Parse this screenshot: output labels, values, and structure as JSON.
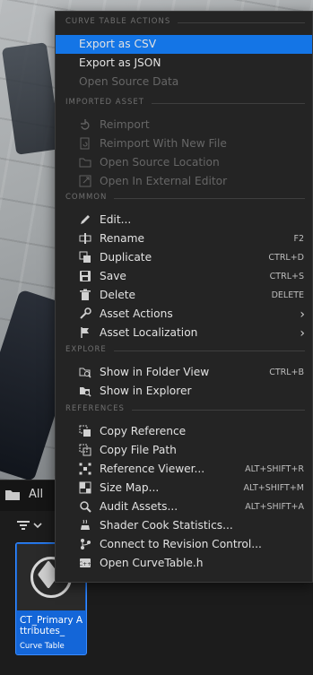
{
  "menu": {
    "sections": [
      {
        "header": "CURVE TABLE ACTIONS",
        "items": [
          {
            "label": "Export as CSV",
            "icon": "none",
            "highlight": true
          },
          {
            "label": "Export as JSON",
            "icon": "none"
          },
          {
            "label": "Open Source Data",
            "icon": "none",
            "disabled": true
          }
        ]
      },
      {
        "header": "IMPORTED ASSET",
        "items": [
          {
            "label": "Reimport",
            "icon": "reimport-icon",
            "disabled": true
          },
          {
            "label": "Reimport With New File",
            "icon": "reimport-new-file-icon",
            "disabled": true
          },
          {
            "label": "Open Source Location",
            "icon": "open-folder-icon",
            "disabled": true
          },
          {
            "label": "Open In External Editor",
            "icon": "external-editor-icon",
            "disabled": true
          }
        ]
      },
      {
        "header": "COMMON",
        "items": [
          {
            "label": "Edit...",
            "icon": "pencil-icon"
          },
          {
            "label": "Rename",
            "icon": "rename-icon",
            "shortcut": "F2"
          },
          {
            "label": "Duplicate",
            "icon": "duplicate-icon",
            "shortcut": "CTRL+D"
          },
          {
            "label": "Save",
            "icon": "save-icon",
            "shortcut": "CTRL+S"
          },
          {
            "label": "Delete",
            "icon": "trash-icon",
            "shortcut": "DELETE"
          },
          {
            "label": "Asset Actions",
            "icon": "wrench-icon",
            "submenu": true
          },
          {
            "label": "Asset Localization",
            "icon": "flag-icon",
            "submenu": true
          }
        ]
      },
      {
        "header": "EXPLORE",
        "items": [
          {
            "label": "Show in Folder View",
            "icon": "folder-search-icon",
            "shortcut": "CTRL+B"
          },
          {
            "label": "Show in Explorer",
            "icon": "explorer-search-icon"
          }
        ]
      },
      {
        "header": "REFERENCES",
        "items": [
          {
            "label": "Copy Reference",
            "icon": "copy-reference-icon"
          },
          {
            "label": "Copy File Path",
            "icon": "copy-path-icon"
          },
          {
            "label": "Reference Viewer...",
            "icon": "reference-viewer-icon",
            "shortcut": "ALT+SHIFT+R"
          },
          {
            "label": "Size Map...",
            "icon": "size-map-icon",
            "shortcut": "ALT+SHIFT+M"
          },
          {
            "label": "Audit Assets...",
            "icon": "audit-icon",
            "shortcut": "ALT+SHIFT+A"
          },
          {
            "label": "Shader Cook Statistics...",
            "icon": "shader-stats-icon"
          },
          {
            "label": "Connect to Revision Control...",
            "icon": "revision-control-icon"
          },
          {
            "label": "Open CurveTable.h",
            "icon": "cpp-file-icon"
          }
        ]
      }
    ]
  },
  "content_browser": {
    "breadcrumb": "All",
    "asset": {
      "name": "CT_Primary Attributes_",
      "type": "Curve Table"
    }
  },
  "colors": {
    "menu_bg": "#242424",
    "highlight": "#1475e6",
    "disabled_text": "#666666",
    "tile_blue": "#1466d8"
  }
}
